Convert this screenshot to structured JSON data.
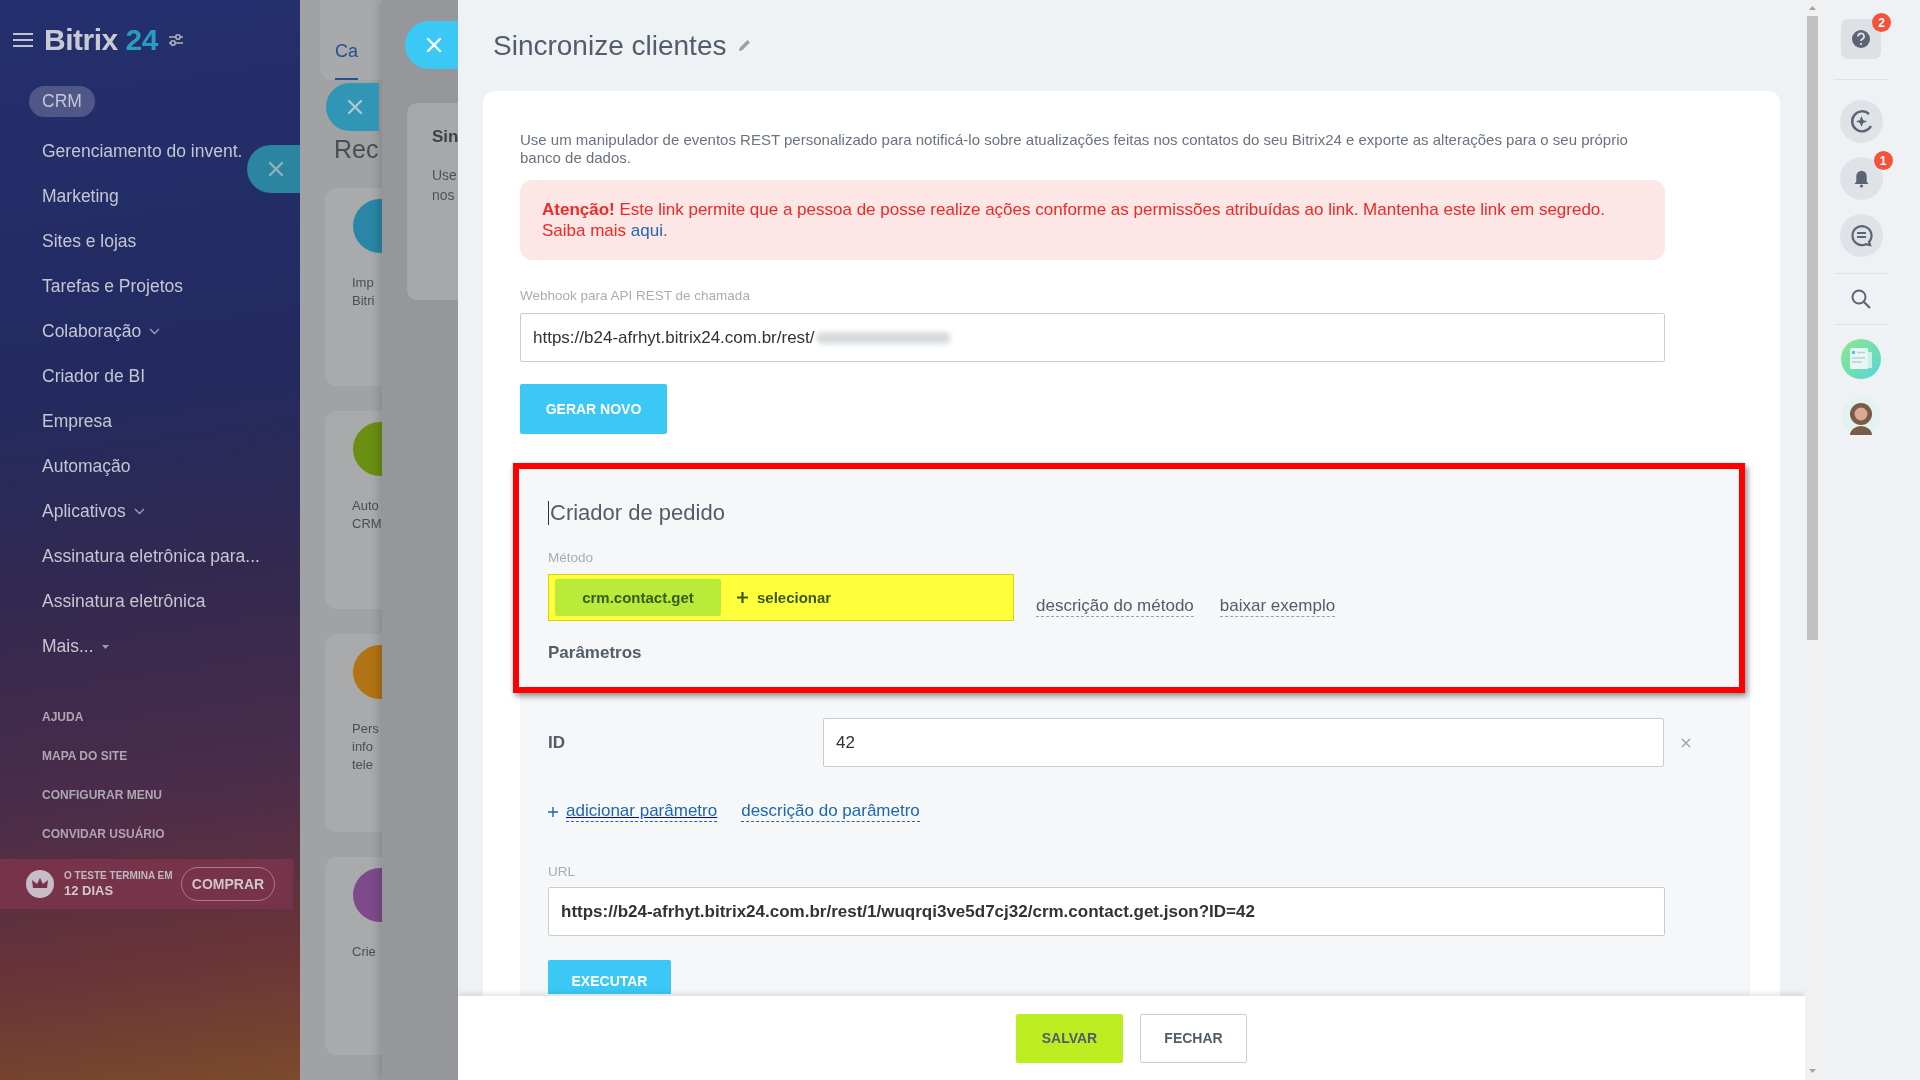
{
  "sidebar": {
    "logo": {
      "name": "Bitrix",
      "suffix": "24"
    },
    "items": [
      {
        "label": "CRM",
        "kind": "link",
        "selected": true
      },
      {
        "label": "Gerenciamento do invent.",
        "kind": "link",
        "selected": false
      },
      {
        "label": "Marketing",
        "kind": "link",
        "selected": false
      },
      {
        "label": "Sites e lojas",
        "kind": "link",
        "selected": false
      },
      {
        "label": "Tarefas e Projetos",
        "kind": "link",
        "selected": false
      },
      {
        "label": "Colaboração",
        "kind": "group",
        "selected": false
      },
      {
        "label": "Criador de BI",
        "kind": "link",
        "selected": false
      },
      {
        "label": "Empresa",
        "kind": "link",
        "selected": false
      },
      {
        "label": "Automação",
        "kind": "link",
        "selected": false
      },
      {
        "label": "Aplicativos",
        "kind": "group",
        "selected": false
      },
      {
        "label": "Assinatura eletrônica para...",
        "kind": "link",
        "selected": false
      },
      {
        "label": "Assinatura eletrônica",
        "kind": "link",
        "selected": false
      },
      {
        "label": "Mais...",
        "kind": "more",
        "selected": false
      }
    ],
    "footer_links": [
      "AJUDA",
      "MAPA DO SITE",
      "CONFIGURAR MENU",
      "CONVIDAR USUÁRIO"
    ],
    "trial": {
      "label": "O TESTE TERMINA EM",
      "days": "12 DIAS",
      "button": "COMPRAR"
    }
  },
  "background_page": {
    "tabs": [
      {
        "label": "Ca",
        "selected": true
      }
    ],
    "heading": "Rec",
    "cards": [
      {
        "color": "#2a86a6",
        "lines": [
          "Imp",
          "Bitri"
        ]
      },
      {
        "color": "#6a8f12",
        "lines": [
          "Auto",
          "CRM"
        ]
      },
      {
        "color": "#b07414",
        "lines": [
          "Pers",
          "info",
          "tele"
        ]
      },
      {
        "color": "#7e4a8c",
        "lines": [
          "Crie"
        ]
      }
    ]
  },
  "middle_slider": {
    "card": {
      "title": "Sin",
      "lines": [
        "Use",
        "nos"
      ]
    }
  },
  "slider": {
    "title": "Sincronize clientes",
    "description": "Use um manipulador de eventos REST personalizado para notificá-lo sobre atualizações feitas nos contatos do seu Bitrix24 e exporte as alterações para o seu próprio banco de dados.",
    "alert": {
      "text": "**Atenção!** Este link permite que a pessoa de posse realize ações conforme as permissões atribuídas ao link. Mantenha este link em segredo.",
      "more": "Saiba mais",
      "link": "aqui",
      "end": "."
    },
    "webhook": {
      "label": "Webhook para API REST de chamada",
      "value": "https://b24-afrhyt.bitrix24.com.br/rest/"
    },
    "generate_button": "GERAR NOVO",
    "builder": {
      "title": "Criador de pedido",
      "method_label": "Método",
      "method": "crm.contact.get",
      "select": "selecionar",
      "method_links": [
        "descrição do método",
        "baixar exemplo"
      ],
      "params_title": "Parâmetros",
      "params": [
        {
          "name": "ID",
          "value": "42"
        }
      ],
      "add_param": "adicionar parâmetro",
      "param_help": "descrição do parâmetro",
      "url_label": "URL",
      "url": "https://b24-afrhyt.bitrix24.com.br/rest/1/wuqrqi3ve5d7cj32/crm.contact.get.json?ID=42",
      "execute": "EXECUTAR"
    },
    "footer_buttons": [
      {
        "label": "SALVAR",
        "kind": "primary"
      },
      {
        "label": "FECHAR",
        "kind": "secondary"
      }
    ]
  },
  "right_rail": {
    "help_badge": "2",
    "notification_badge": "1"
  }
}
